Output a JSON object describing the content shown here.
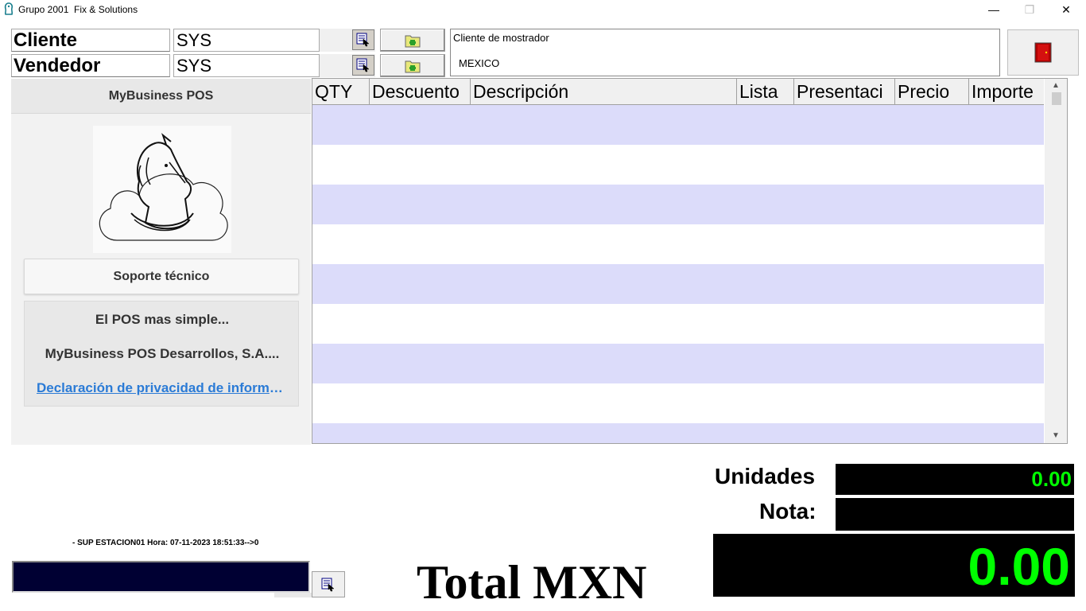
{
  "titlebar": {
    "title": "Grupo 2001  Fix & Solutions",
    "app_icon": "app-logo-icon",
    "minimize_glyph": "—",
    "restore_glyph": "❐",
    "close_glyph": "✕"
  },
  "header": {
    "cliente_label": "Cliente",
    "cliente_value": "SYS",
    "vendedor_label": "Vendedor",
    "vendedor_value": "SYS",
    "picker_icon": "lookup-icon",
    "add_icon": "add-folder-icon"
  },
  "client_info": {
    "name": "Cliente de mostrador",
    "city": "MEXICO"
  },
  "exit_icon": "exit-door-icon",
  "left_panel": {
    "brand_title": "MyBusiness POS",
    "logo_icon": "horse-cloud-logo",
    "support_button": "Soporte técnico",
    "tagline": "El POS mas simple...",
    "company": "MyBusiness POS Desarrollos, S.A....",
    "privacy_link": "Declaración de privacidad de informaci..."
  },
  "grid": {
    "columns": [
      "QTY",
      "Descuento",
      "Descripción",
      "Lista",
      "Presentaci",
      "Precio",
      "Importe"
    ],
    "rows": []
  },
  "footer": {
    "status": "- SUP ESTACION01 Hora: 07-11-2023 18:51:33-->0",
    "scan_value": "",
    "total_label": "Total MXN",
    "units_label": "Unidades",
    "units_value": "0.00",
    "note_label": "Nota:",
    "note_value": "",
    "total_value": "0.00"
  },
  "colors": {
    "row_alt": "#dcdcfa",
    "display_bg": "#000000",
    "display_text": "#00ff00",
    "link": "#2b7bd6"
  }
}
